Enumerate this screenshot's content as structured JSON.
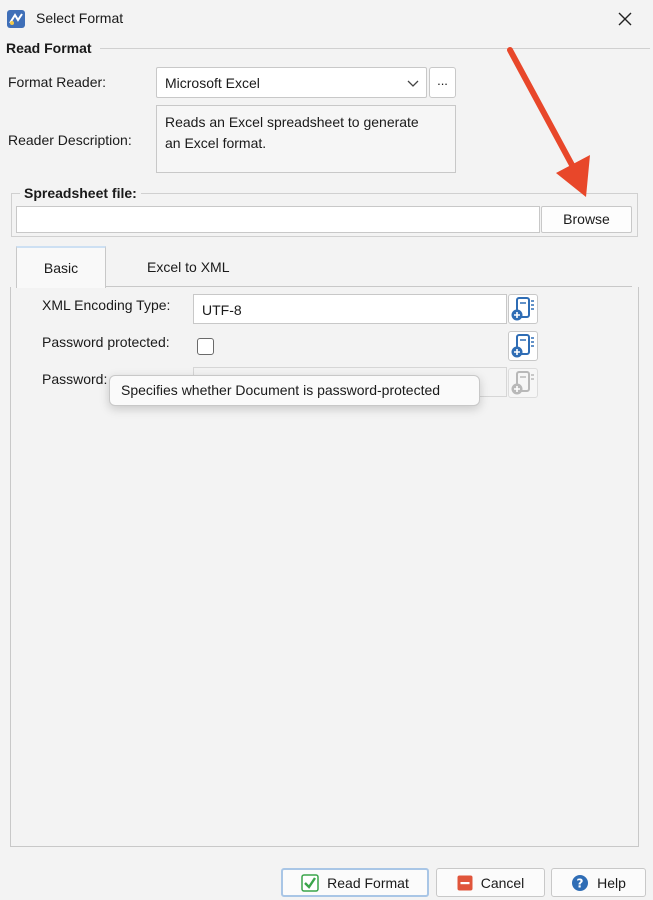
{
  "window": {
    "title": "Select Format",
    "close_icon": "close-icon",
    "app_icon": "app-logo-icon"
  },
  "read_format": {
    "legend": "Read Format",
    "format_reader_label": "Format Reader:",
    "format_reader_value": "Microsoft Excel",
    "ellipsis_label": "...",
    "reader_description_label": "Reader Description:",
    "reader_description_line1": "Reads an Excel spreadsheet to generate",
    "reader_description_line2": "an Excel format."
  },
  "spreadsheet": {
    "legend": "Spreadsheet file:",
    "file_value": "",
    "browse_label": "Browse"
  },
  "tabs": [
    {
      "label": "Basic",
      "active": true
    },
    {
      "label": "Excel to XML",
      "active": false
    }
  ],
  "basic": {
    "encoding_label": "XML Encoding Type:",
    "encoding_value": "UTF-8",
    "password_protected_label": "Password protected:",
    "password_protected_checked": false,
    "password_label": "Password:",
    "password_value": ""
  },
  "tooltip": {
    "text": "Specifies whether Document is password-protected"
  },
  "footer": {
    "read_format_label": "Read Format",
    "cancel_label": "Cancel",
    "help_label": "Help"
  },
  "colors": {
    "accent_arrow": "#e8472a",
    "check_green": "#3aa54a",
    "cancel_red": "#e0553b",
    "help_blue": "#2f6db5"
  }
}
